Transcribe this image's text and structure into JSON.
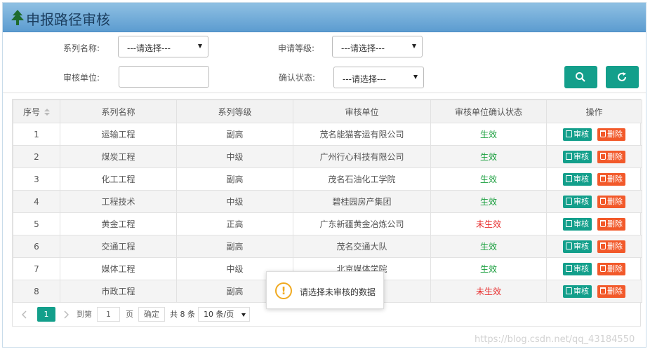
{
  "header": {
    "title": "申报路径审核",
    "icon": "tree-icon"
  },
  "filters": {
    "series_name_label": "系列名称:",
    "series_name_value": "---请选择---",
    "apply_level_label": "申请等级:",
    "apply_level_value": "---请选择---",
    "audit_unit_label": "审核单位:",
    "audit_unit_value": "",
    "confirm_status_label": "确认状态:",
    "confirm_status_value": "---请选择---",
    "search_icon": "search-icon",
    "refresh_icon": "refresh-icon"
  },
  "table": {
    "headers": [
      "序号",
      "系列名称",
      "系列等级",
      "审核单位",
      "审核单位确认状态",
      "操作"
    ],
    "audit_label": "审核",
    "delete_label": "删除",
    "rows": [
      {
        "no": "1",
        "name": "运输工程",
        "level": "副高",
        "unit": "茂名能猫客运有限公司",
        "status": "生效"
      },
      {
        "no": "2",
        "name": "煤炭工程",
        "level": "中级",
        "unit": "广州行心科技有限公司",
        "status": "生效"
      },
      {
        "no": "3",
        "name": "化工工程",
        "level": "副高",
        "unit": "茂名石油化工学院",
        "status": "生效"
      },
      {
        "no": "4",
        "name": "工程技术",
        "level": "中级",
        "unit": "碧桂园房产集团",
        "status": "生效"
      },
      {
        "no": "5",
        "name": "黄金工程",
        "level": "正高",
        "unit": "广东新疆黄金冶炼公司",
        "status": "未生效"
      },
      {
        "no": "6",
        "name": "交通工程",
        "level": "副高",
        "unit": "茂名交通大队",
        "status": "生效"
      },
      {
        "no": "7",
        "name": "媒体工程",
        "level": "中级",
        "unit": "北京媒体学院",
        "status": "生效"
      },
      {
        "no": "8",
        "name": "市政工程",
        "level": "副高",
        "unit": "",
        "status": "未生效"
      }
    ]
  },
  "pager": {
    "current": "1",
    "goto_label": "到第",
    "goto_value": "1",
    "page_label": "页",
    "confirm_label": "确定",
    "total_label": "共 8 条",
    "per_page": "10 条/页"
  },
  "toast": {
    "message": "请选择未审核的数据"
  },
  "watermark": "https://blog.csdn.net/qq_43184550",
  "colors": {
    "accent": "#139f8b",
    "danger": "#f2592a",
    "ok": "#189e3c",
    "warn": "#f0a91f"
  }
}
